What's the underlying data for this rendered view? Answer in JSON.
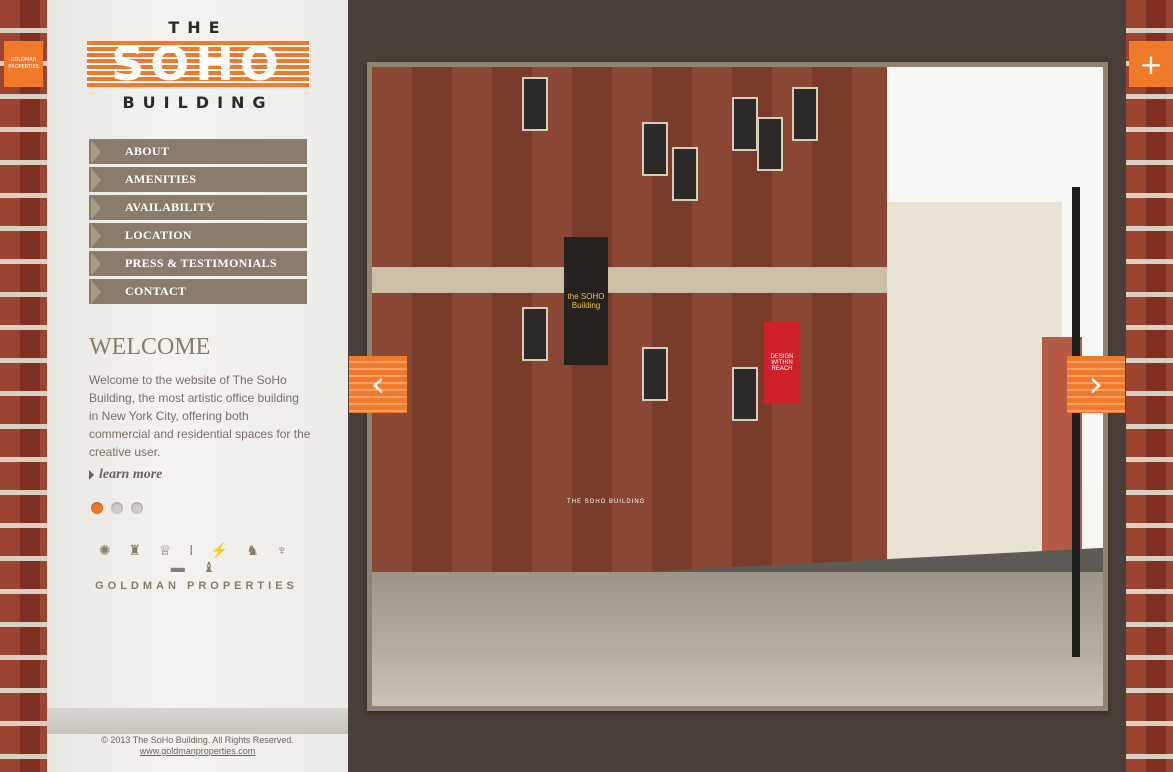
{
  "logo": {
    "top": "THE",
    "main": "SOHO",
    "bottom": "BUILDING",
    "side_tab": "GOLDMAN PROPERTIES"
  },
  "nav": [
    {
      "label": "ABOUT"
    },
    {
      "label": "AMENITIES"
    },
    {
      "label": "AVAILABILITY"
    },
    {
      "label": "LOCATION"
    },
    {
      "label": "PRESS & TESTIMONIALS"
    },
    {
      "label": "CONTACT"
    }
  ],
  "welcome": {
    "title": "WELCOME",
    "text": "Welcome to the website of The SoHo Building, the most artistic office building in New York City, offering both commercial and residential spaces for the creative user.",
    "learn_more": "learn more"
  },
  "slides": {
    "count": 3,
    "active": 1
  },
  "partner": {
    "icons": "✺ ♜ ♕ ǀ ⚡ ♞ ♆ ▬ ♝",
    "name": "GOLDMAN PROPERTIES"
  },
  "footer": {
    "copyright": "© 2013 The SoHo Building. All Rights Reserved.",
    "link": "www.goldmanproperties.com"
  },
  "photo": {
    "banner_1": "the SOHO Building",
    "banner_2": "DESIGN WITHIN REACH",
    "facade_sign": "THE SOHO BUILDING"
  },
  "controls": {
    "prev": "‹",
    "next": "›",
    "expand": "+"
  },
  "colors": {
    "accent": "#f07a2a",
    "nav": "#8a7c6b",
    "background": "#4a403a"
  }
}
